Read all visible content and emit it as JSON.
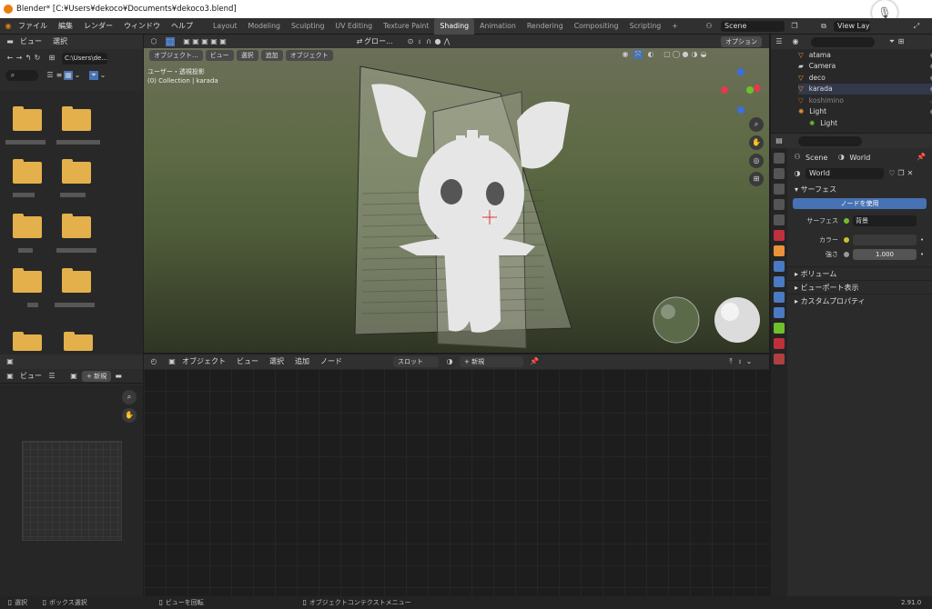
{
  "titlebar": {
    "title": "Blender* [C:¥Users¥dekoco¥Documents¥dekoco3.blend]"
  },
  "menu": [
    "ファイル",
    "編集",
    "レンダー",
    "ウィンドウ",
    "ヘルプ"
  ],
  "workspaces": [
    "Layout",
    "Modeling",
    "Sculpting",
    "UV Editing",
    "Texture Paint",
    "Shading",
    "Animation",
    "Rendering",
    "Compositing",
    "Scripting"
  ],
  "active_workspace": "Shading",
  "scene": "Scene",
  "view_layer": "View Layer",
  "filebrowser": {
    "menu": [
      "ビュー",
      "選択"
    ],
    "path": "C:\\Users\\de..."
  },
  "viewport": {
    "mode": "オブジェクト...",
    "menus": [
      "ビュー",
      "選択",
      "追加",
      "オブジェクト"
    ],
    "orientation": "グロー...",
    "options": "オプション",
    "info1": "ユーザー・透視投影",
    "info2": "(0) Collection | karada"
  },
  "outliner": {
    "items": [
      {
        "name": "atama"
      },
      {
        "name": "Camera"
      },
      {
        "name": "deco"
      },
      {
        "name": "karada"
      },
      {
        "name": "koshimino"
      },
      {
        "name": "Light"
      },
      {
        "name": "Light"
      }
    ]
  },
  "properties": {
    "breadcrumb_scene": "Scene",
    "breadcrumb_world": "World",
    "world_name": "World",
    "surface_section": "サーフェス",
    "use_nodes": "ノードを使用",
    "surface_label": "サーフェス",
    "surface_value": "背景",
    "color_label": "カラー",
    "strength_label": "強さ",
    "strength_value": "1.000",
    "volume_section": "ボリューム",
    "viewport_section": "ビューポート表示",
    "custom_section": "カスタムプロパティ"
  },
  "imageeditor": {
    "view": "ビュー",
    "new": "新規"
  },
  "nodeeditor": {
    "mode": "オブジェクト",
    "menus": [
      "ビュー",
      "選択",
      "追加",
      "ノード"
    ],
    "slot": "スロット",
    "new": "新規"
  },
  "status": {
    "select": "選択",
    "box": "ボックス選択",
    "rotate": "ビューを回転",
    "context": "オブジェクトコンテクストメニュー",
    "version": "2.91.0"
  }
}
